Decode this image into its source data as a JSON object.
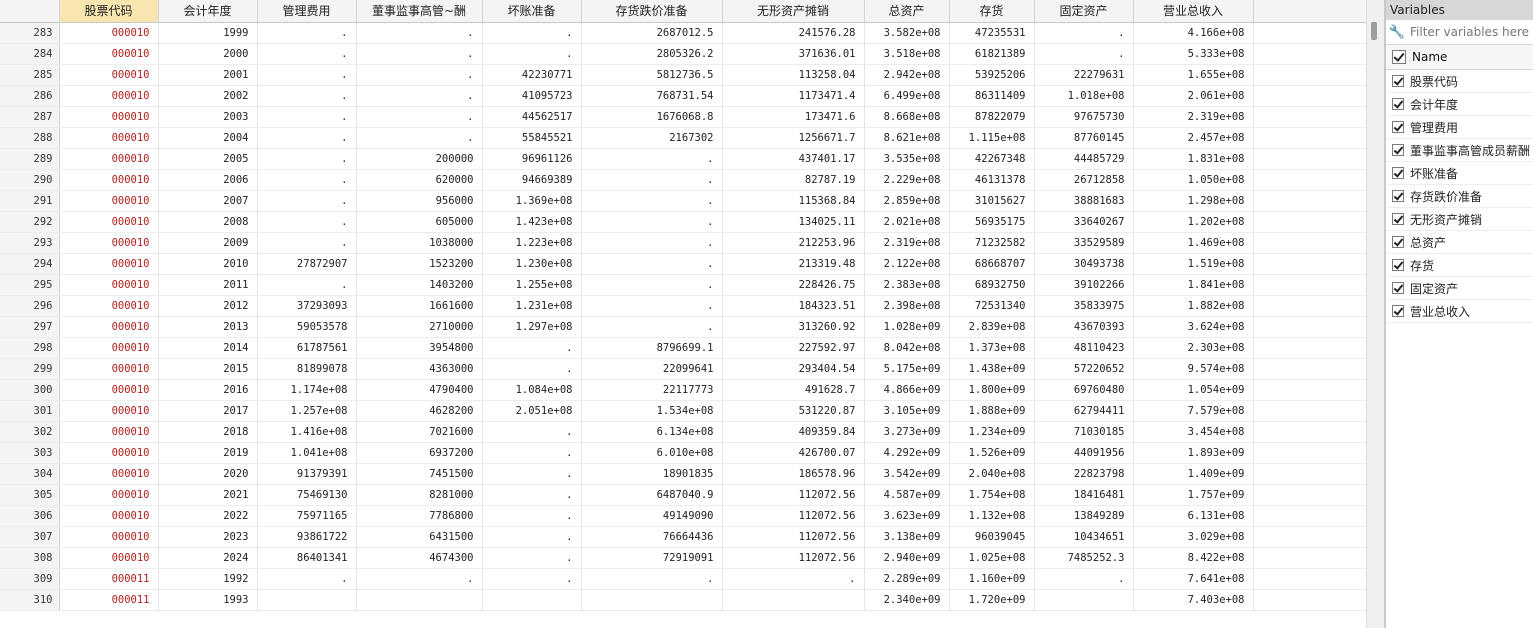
{
  "grid": {
    "columns": [
      "",
      "股票代码",
      "会计年度",
      "管理费用",
      "董事监事高管~酬",
      "坏账准备",
      "存货跌价准备",
      "无形资产摊销",
      "总资产",
      "存货",
      "固定资产",
      "营业总收入",
      ""
    ],
    "rows": [
      [
        "283",
        "000010",
        "1999",
        ".",
        ".",
        ".",
        "2687012.5",
        "241576.28",
        "3.582e+08",
        "47235531",
        ".",
        "4.166e+08"
      ],
      [
        "284",
        "000010",
        "2000",
        ".",
        ".",
        ".",
        "2805326.2",
        "371636.01",
        "3.518e+08",
        "61821389",
        ".",
        "5.333e+08"
      ],
      [
        "285",
        "000010",
        "2001",
        ".",
        ".",
        "42230771",
        "5812736.5",
        "113258.04",
        "2.942e+08",
        "53925206",
        "22279631",
        "1.655e+08"
      ],
      [
        "286",
        "000010",
        "2002",
        ".",
        ".",
        "41095723",
        "768731.54",
        "1173471.4",
        "6.499e+08",
        "86311409",
        "1.018e+08",
        "2.061e+08"
      ],
      [
        "287",
        "000010",
        "2003",
        ".",
        ".",
        "44562517",
        "1676068.8",
        "173471.6",
        "8.668e+08",
        "87822079",
        "97675730",
        "2.319e+08"
      ],
      [
        "288",
        "000010",
        "2004",
        ".",
        ".",
        "55845521",
        "2167302",
        "1256671.7",
        "8.621e+08",
        "1.115e+08",
        "87760145",
        "2.457e+08"
      ],
      [
        "289",
        "000010",
        "2005",
        ".",
        "200000",
        "96961126",
        ".",
        "437401.17",
        "3.535e+08",
        "42267348",
        "44485729",
        "1.831e+08"
      ],
      [
        "290",
        "000010",
        "2006",
        ".",
        "620000",
        "94669389",
        ".",
        "82787.19",
        "2.229e+08",
        "46131378",
        "26712858",
        "1.050e+08"
      ],
      [
        "291",
        "000010",
        "2007",
        ".",
        "956000",
        "1.369e+08",
        ".",
        "115368.84",
        "2.859e+08",
        "31015627",
        "38881683",
        "1.298e+08"
      ],
      [
        "292",
        "000010",
        "2008",
        ".",
        "605000",
        "1.423e+08",
        ".",
        "134025.11",
        "2.021e+08",
        "56935175",
        "33640267",
        "1.202e+08"
      ],
      [
        "293",
        "000010",
        "2009",
        ".",
        "1038000",
        "1.223e+08",
        ".",
        "212253.96",
        "2.319e+08",
        "71232582",
        "33529589",
        "1.469e+08"
      ],
      [
        "294",
        "000010",
        "2010",
        "27872907",
        "1523200",
        "1.230e+08",
        ".",
        "213319.48",
        "2.122e+08",
        "68668707",
        "30493738",
        "1.519e+08"
      ],
      [
        "295",
        "000010",
        "2011",
        ".",
        "1403200",
        "1.255e+08",
        ".",
        "228426.75",
        "2.383e+08",
        "68932750",
        "39102266",
        "1.841e+08"
      ],
      [
        "296",
        "000010",
        "2012",
        "37293093",
        "1661600",
        "1.231e+08",
        ".",
        "184323.51",
        "2.398e+08",
        "72531340",
        "35833975",
        "1.882e+08"
      ],
      [
        "297",
        "000010",
        "2013",
        "59053578",
        "2710000",
        "1.297e+08",
        ".",
        "313260.92",
        "1.028e+09",
        "2.839e+08",
        "43670393",
        "3.624e+08"
      ],
      [
        "298",
        "000010",
        "2014",
        "61787561",
        "3954800",
        ".",
        "8796699.1",
        "227592.97",
        "8.042e+08",
        "1.373e+08",
        "48110423",
        "2.303e+08"
      ],
      [
        "299",
        "000010",
        "2015",
        "81899078",
        "4363000",
        ".",
        "22099641",
        "293404.54",
        "5.175e+09",
        "1.438e+09",
        "57220652",
        "9.574e+08"
      ],
      [
        "300",
        "000010",
        "2016",
        "1.174e+08",
        "4790400",
        "1.084e+08",
        "22117773",
        "491628.7",
        "4.866e+09",
        "1.800e+09",
        "69760480",
        "1.054e+09"
      ],
      [
        "301",
        "000010",
        "2017",
        "1.257e+08",
        "4628200",
        "2.051e+08",
        "1.534e+08",
        "531220.87",
        "3.105e+09",
        "1.888e+09",
        "62794411",
        "7.579e+08"
      ],
      [
        "302",
        "000010",
        "2018",
        "1.416e+08",
        "7021600",
        ".",
        "6.134e+08",
        "409359.84",
        "3.273e+09",
        "1.234e+09",
        "71030185",
        "3.454e+08"
      ],
      [
        "303",
        "000010",
        "2019",
        "1.041e+08",
        "6937200",
        ".",
        "6.010e+08",
        "426700.07",
        "4.292e+09",
        "1.526e+09",
        "44091956",
        "1.893e+09"
      ],
      [
        "304",
        "000010",
        "2020",
        "91379391",
        "7451500",
        ".",
        "18901835",
        "186578.96",
        "3.542e+09",
        "2.040e+08",
        "22823798",
        "1.409e+09"
      ],
      [
        "305",
        "000010",
        "2021",
        "75469130",
        "8281000",
        ".",
        "6487040.9",
        "112072.56",
        "4.587e+09",
        "1.754e+08",
        "18416481",
        "1.757e+09"
      ],
      [
        "306",
        "000010",
        "2022",
        "75971165",
        "7786800",
        ".",
        "49149090",
        "112072.56",
        "3.623e+09",
        "1.132e+08",
        "13849289",
        "6.131e+08"
      ],
      [
        "307",
        "000010",
        "2023",
        "93861722",
        "6431500",
        ".",
        "76664436",
        "112072.56",
        "3.138e+09",
        "96039045",
        "10434651",
        "3.029e+08"
      ],
      [
        "308",
        "000010",
        "2024",
        "86401341",
        "4674300",
        ".",
        "72919091",
        "112072.56",
        "2.940e+09",
        "1.025e+08",
        "7485252.3",
        "8.422e+08"
      ],
      [
        "309",
        "000011",
        "1992",
        ".",
        ".",
        ".",
        ".",
        ".",
        "2.289e+09",
        "1.160e+09",
        ".",
        "7.641e+08"
      ],
      [
        "310",
        "000011",
        "1993",
        "",
        "",
        "",
        "",
        "",
        "2.340e+09",
        "1.720e+09",
        "",
        "7.403e+08"
      ]
    ]
  },
  "panel": {
    "title": "Variables",
    "filter_placeholder": "Filter variables here",
    "name_header": "Name",
    "variables": [
      "股票代码",
      "会计年度",
      "管理费用",
      "董事监事高管成员薪酬",
      "坏账准备",
      "存货跌价准备",
      "无形资产摊销",
      "总资产",
      "存货",
      "固定资产",
      "营业总收入"
    ]
  },
  "icons": {
    "filter": "wrench-icon",
    "check": "checkbox-checked-icon"
  },
  "colors": {
    "selected_header": "#f7e6b0",
    "code_text": "#b0211e",
    "panel_title_bg": "#d7d7d7"
  }
}
